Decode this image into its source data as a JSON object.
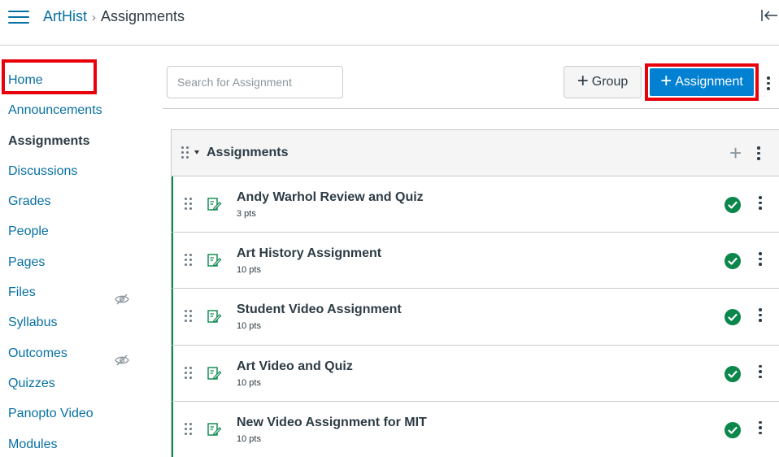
{
  "header": {
    "course_link": "ArtHist",
    "separator": "›",
    "current_page": "Assignments",
    "menu_icon": "hamburger-menu-icon",
    "collapse_icon": "collapse-panel-icon"
  },
  "sidebar": {
    "items": [
      {
        "label": "Home",
        "active": false,
        "hidden": false
      },
      {
        "label": "Announcements",
        "active": false,
        "hidden": false
      },
      {
        "label": "Assignments",
        "active": true,
        "hidden": false
      },
      {
        "label": "Discussions",
        "active": false,
        "hidden": false
      },
      {
        "label": "Grades",
        "active": false,
        "hidden": false
      },
      {
        "label": "People",
        "active": false,
        "hidden": false
      },
      {
        "label": "Pages",
        "active": false,
        "hidden": false
      },
      {
        "label": "Files",
        "active": false,
        "hidden": true
      },
      {
        "label": "Syllabus",
        "active": false,
        "hidden": false
      },
      {
        "label": "Outcomes",
        "active": false,
        "hidden": true
      },
      {
        "label": "Quizzes",
        "active": false,
        "hidden": false
      },
      {
        "label": "Panopto Video",
        "active": false,
        "hidden": false
      },
      {
        "label": "Modules",
        "active": false,
        "hidden": false
      }
    ]
  },
  "toolbar": {
    "search_placeholder": "Search for Assignment",
    "group_button": "Group",
    "assignment_button": "Assignment"
  },
  "group": {
    "title": "Assignments",
    "assignments": [
      {
        "title": "Andy Warhol Review and Quiz",
        "points": "3 pts",
        "published": true
      },
      {
        "title": "Art History Assignment",
        "points": "10 pts",
        "published": true
      },
      {
        "title": "Student Video Assignment",
        "points": "10 pts",
        "published": true
      },
      {
        "title": "Art Video and Quiz",
        "points": "10 pts",
        "published": true
      },
      {
        "title": "New Video Assignment for MIT",
        "points": "10 pts",
        "published": true
      }
    ]
  },
  "colors": {
    "link": "#0770a3",
    "primary_button": "#0281d2",
    "published": "#0b874b",
    "highlight": "#e8000b",
    "text": "#2d3b45"
  }
}
